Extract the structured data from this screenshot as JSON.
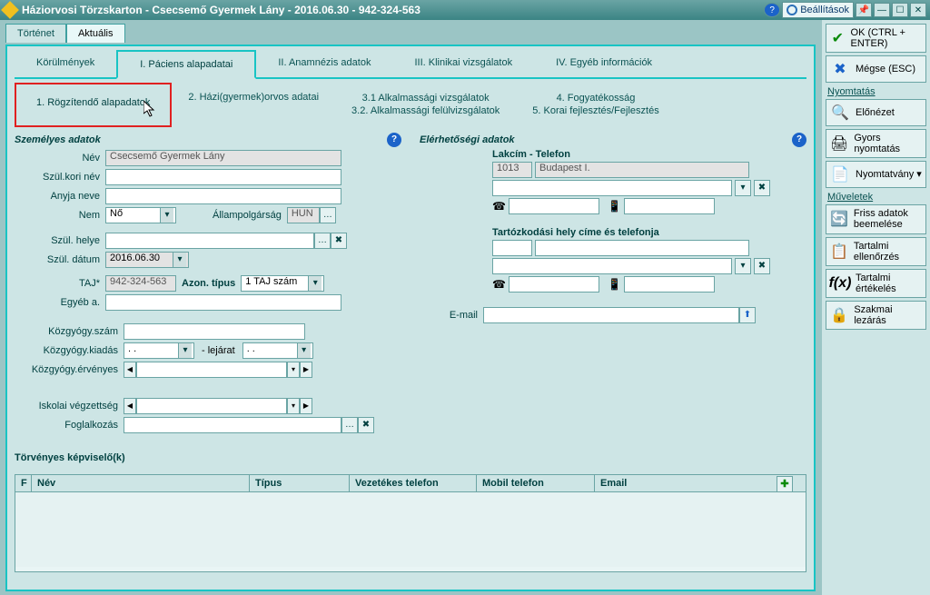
{
  "titlebar": {
    "title": "Háziorvosi Törzskarton - Csecsemő Gyermek Lány - 2016.06.30 - 942-324-563",
    "settings": "Beállítások",
    "pin": "📌",
    "help": "?"
  },
  "rightpanel": {
    "ok": "OK (CTRL + ENTER)",
    "cancel": "Mégse (ESC)",
    "print_section": "Nyomtatás",
    "preview": "Előnézet",
    "quickprint": "Gyors nyomtatás",
    "form": "Nyomtatvány ▾",
    "ops_section": "Műveletek",
    "refresh": "Friss adatok beemelése",
    "contentcheck": "Tartalmi ellenőrzés",
    "contenteval": "Tartalmi értékelés",
    "lock": "Szakmai lezárás"
  },
  "tabs": {
    "history": "Történet",
    "current": "Aktuális"
  },
  "subtabs1": {
    "t1": "Körülmények",
    "t2": "I. Páciens alapadatai",
    "t3": "II. Anamnézis adatok",
    "t4": "III. Klinikai vizsgálatok",
    "t5": "IV. Egyéb információk"
  },
  "subtabs2": {
    "t1": "1. Rögzítendő alapadatok",
    "t2": "2. Házi(gyermek)orvos adatai",
    "t3a": "3.1 Alkalmassági vizsgálatok",
    "t3b": "3.2. Alkalmassági felülvizsgálatok",
    "t4a": "4. Fogyatékosság",
    "t4b": "5. Korai fejlesztés/Fejlesztés"
  },
  "personal": {
    "section": "Személyes adatok",
    "name_lbl": "Név",
    "name": "Csecsemő Gyermek Lány",
    "birthname_lbl": "Szül.kori név",
    "mother_lbl": "Anyja neve",
    "sex_lbl": "Nem",
    "sex": "Nő",
    "citizenship_lbl": "Állampolgárság",
    "citizenship": "HUN",
    "birthplace_lbl": "Szül. helye",
    "birthdate_lbl": "Szül. dátum",
    "birthdate": "2016.06.30",
    "taj_lbl": "TAJ*",
    "taj": "942-324-563",
    "idtype_lbl": "Azon. típus",
    "idtype": "1 TAJ szám",
    "otherid_lbl": "Egyéb a.",
    "kozgy_num_lbl": "Közgyógy.szám",
    "kozgy_issue_lbl": "Közgyógy.kiadás",
    "kozgy_issue": "  .    .",
    "kozgy_exp_lbl": "- lejárat",
    "kozgy_exp": "  .    .",
    "kozgy_valid_lbl": "Közgyógy.érvényes",
    "school_lbl": "Iskolai végzettség",
    "job_lbl": "Foglalkozás"
  },
  "contact": {
    "section": "Elérhetőségi adatok",
    "addr_phone": "Lakcím - Telefon",
    "zip": "1013",
    "city": "Budapest I.",
    "stay_addr": "Tartózkodási hely címe és telefonja",
    "email_lbl": "E-mail"
  },
  "guardians": {
    "title": "Törvényes képviselő(k)",
    "cols": {
      "f": "F",
      "name": "Név",
      "type": "Típus",
      "landline": "Vezetékes telefon",
      "mobile": "Mobil telefon",
      "email": "Email"
    }
  }
}
